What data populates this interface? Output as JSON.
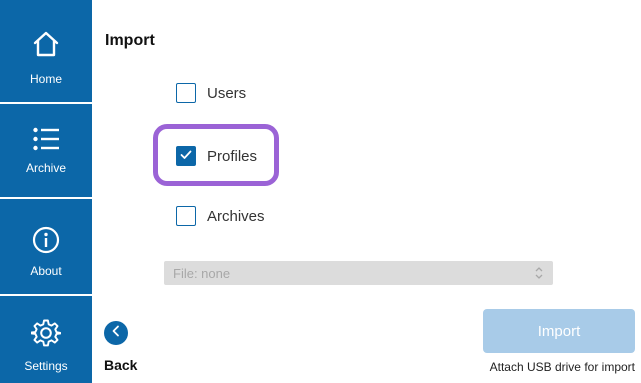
{
  "sidebar": {
    "items": [
      {
        "label": "Home",
        "icon": "home-icon"
      },
      {
        "label": "Archive",
        "icon": "list-icon"
      },
      {
        "label": "About",
        "icon": "info-icon"
      },
      {
        "label": "Settings",
        "icon": "gear-icon"
      }
    ]
  },
  "page": {
    "title": "Import"
  },
  "options": [
    {
      "label": "Users",
      "checked": false
    },
    {
      "label": "Profiles",
      "checked": true
    },
    {
      "label": "Archives",
      "checked": false
    }
  ],
  "file_select": {
    "value": "File: none"
  },
  "back": {
    "label": "Back"
  },
  "import_button": {
    "label": "Import",
    "enabled": false
  },
  "import_hint": "Attach USB drive for import",
  "colors": {
    "sidebar": "#0c67a8",
    "highlight": "#9b63d6",
    "import_disabled": "#a8cbe8"
  }
}
